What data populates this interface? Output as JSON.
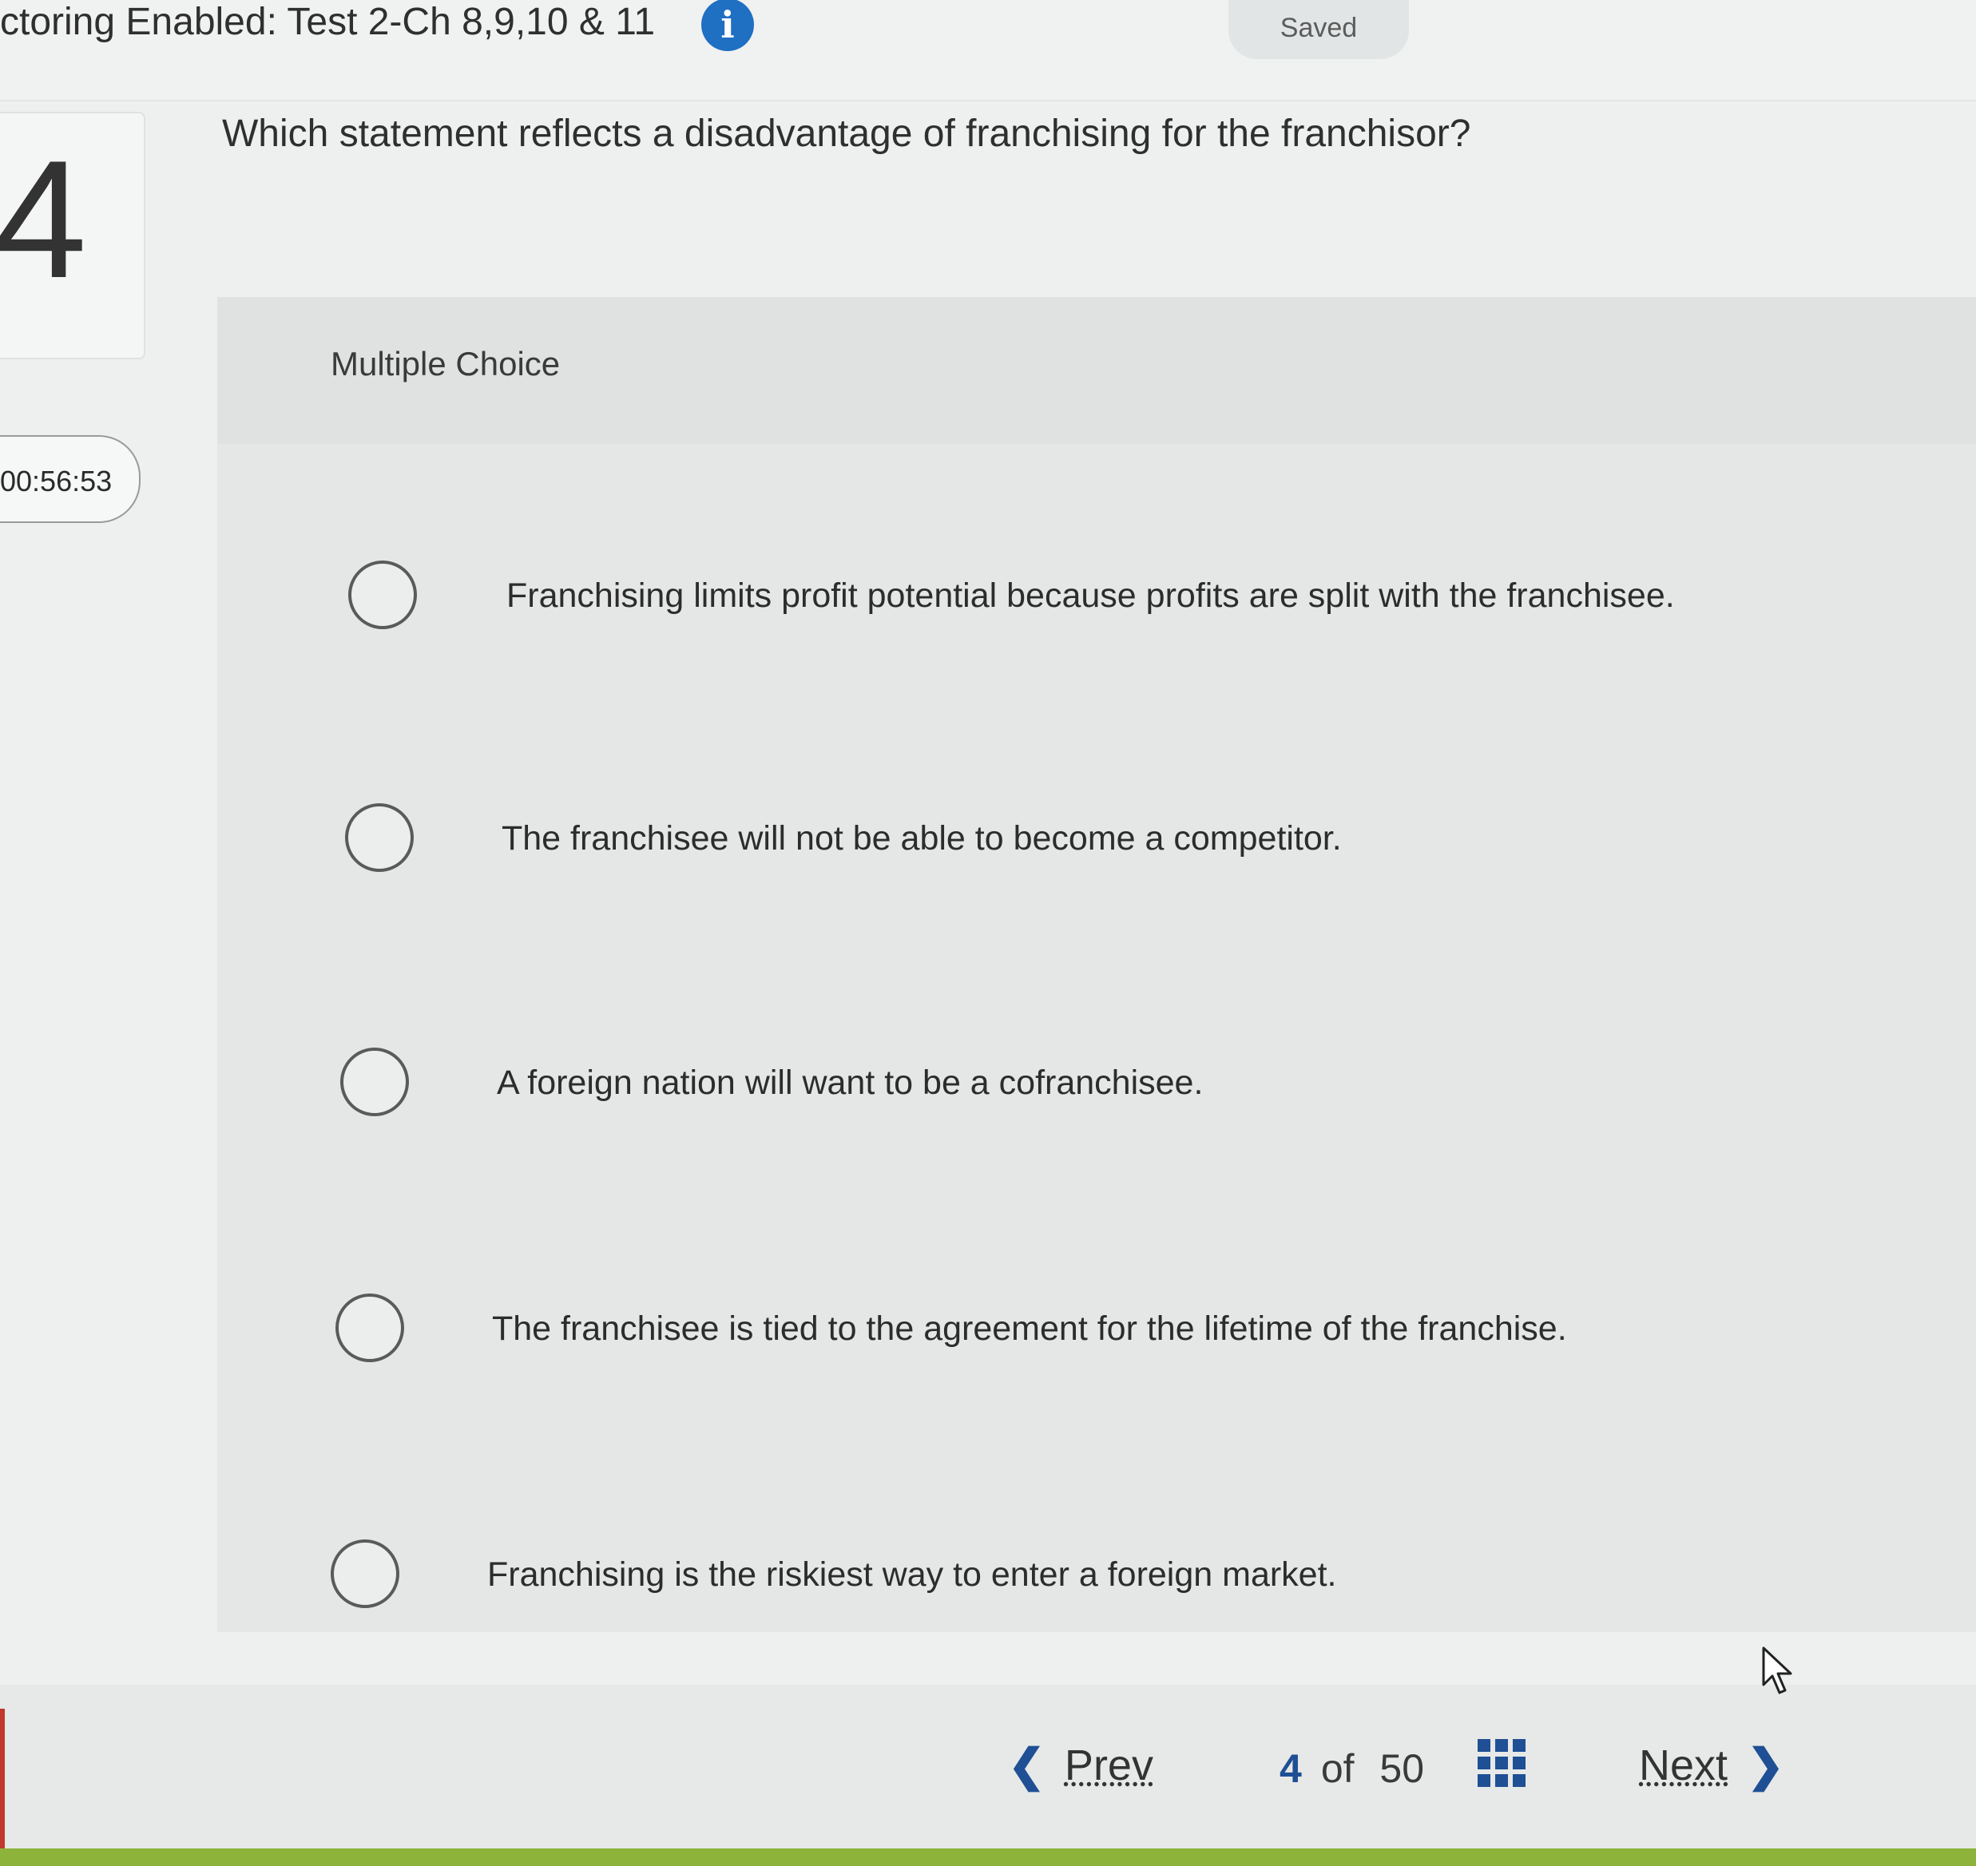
{
  "header": {
    "title": "ctoring Enabled: Test 2-Ch 8,9,10 & 11",
    "info_icon": "i",
    "saved_label": "Saved"
  },
  "question": {
    "number": "4",
    "timer": "00:56:53",
    "text": "Which statement reflects a disadvantage of franchising for the franchisor?",
    "type_label": "Multiple Choice",
    "choices": [
      {
        "label": "Franchising limits profit potential because profits are split with the franchisee.",
        "selected": false
      },
      {
        "label": "The franchisee will not be able to become a competitor.",
        "selected": false
      },
      {
        "label": "A foreign nation will want to be a cofranchisee.",
        "selected": false
      },
      {
        "label": "The franchisee is tied to the agreement for the lifetime of the franchise.",
        "selected": false
      },
      {
        "label": "Franchising is the riskiest way to enter a foreign market.",
        "selected": false
      }
    ]
  },
  "footer": {
    "prev_label": "Prev",
    "prev_icon": "chevron-left-icon",
    "current_page": "4",
    "of_label": "of",
    "total_pages": "50",
    "grid_icon": "grid-icon",
    "next_label": "Next",
    "next_icon": "chevron-right-icon"
  },
  "colors": {
    "accent": "#1f4f94",
    "info": "#1f6fc2",
    "bottom_strip": "#8db33a"
  }
}
